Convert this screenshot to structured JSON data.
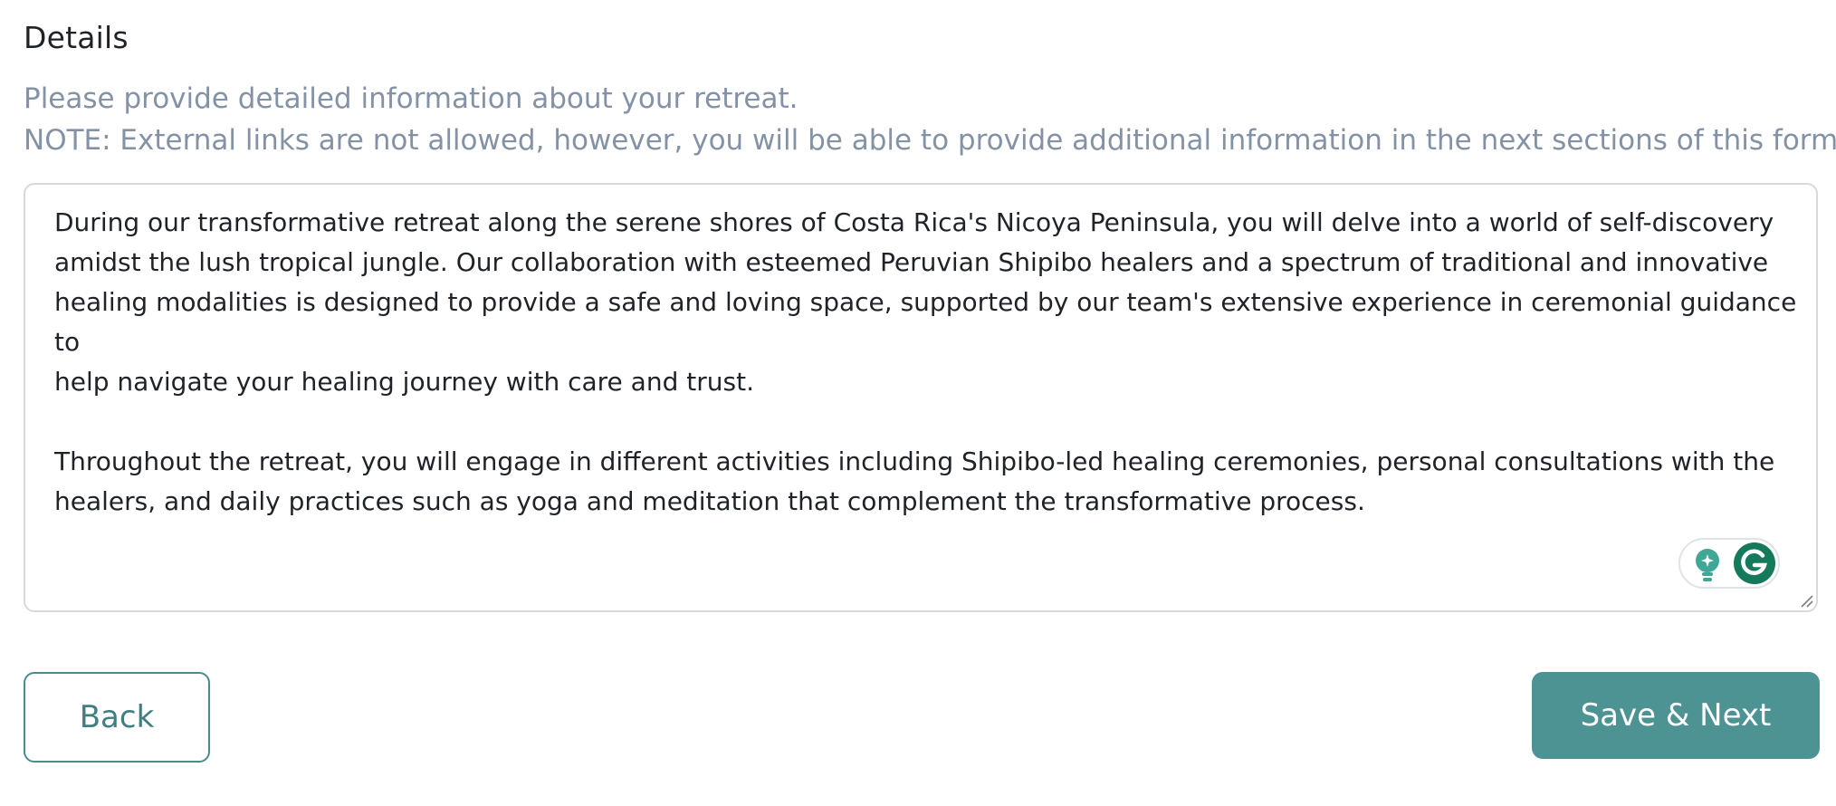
{
  "section": {
    "title": "Details",
    "help_line_1": "Please provide detailed information about your retreat.",
    "help_line_2": "NOTE: External links are not allowed, however, you will be able to provide additional information in the next sections of this form."
  },
  "details_field": {
    "value": "During our transformative retreat along the serene shores of Costa Rica's Nicoya Peninsula, you will delve into a world of self-discovery\namidst the lush tropical jungle. Our collaboration with esteemed Peruvian Shipibo healers and a spectrum of traditional and innovative\nhealing modalities is designed to provide a safe and loving space, supported by our team's extensive experience in ceremonial guidance to\nhelp navigate your healing journey with care and trust.\n\nThroughout the retreat, you will engage in different activities including Shipibo-led healing ceremonies, personal consultations with the\nhealers, and daily practices such as yoga and meditation that complement the transformative process."
  },
  "grammarly": {
    "icons": [
      "lightbulb-icon",
      "grammarly-g-icon"
    ],
    "colors": {
      "bulb": "#3fa796",
      "g": "#15795b"
    }
  },
  "actions": {
    "back_label": "Back",
    "next_label": "Save & Next"
  },
  "colors": {
    "accent": "#4e9393",
    "help_text": "#8492a6",
    "body_text": "#1f2328"
  }
}
